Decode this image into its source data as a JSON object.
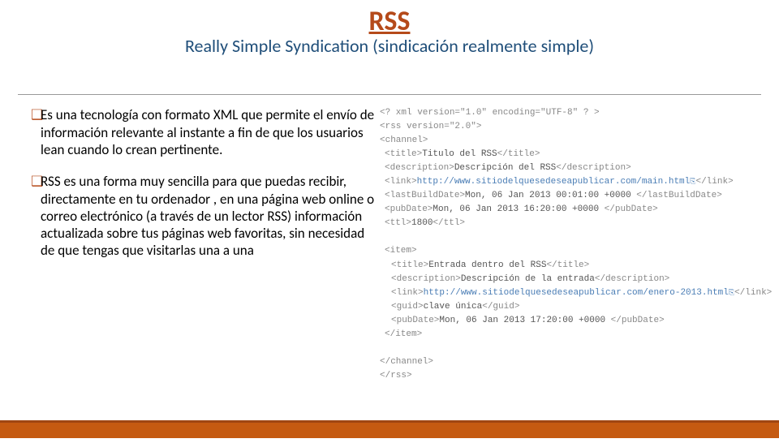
{
  "title": "RSS",
  "subtitle": "Really Simple Syndication (sindicación realmente simple)",
  "bullets": {
    "b1": "Es una  tecnología con formato XML que permite el envío de información relevante al instante a fin de que los usuarios lean cuando lo crean pertinente.",
    "b2": "RSS es una forma muy sencilla para que puedas recibir, directamente en tu ordenador , en una página web online o correo electrónico (a través de un lector RSS) información actualizada sobre tus páginas web favoritas, sin necesidad de que tengas que visitarlas una a una"
  },
  "code": {
    "l1": "<? xml version=\"1.0\" encoding=\"UTF-8\" ? >",
    "l2": "<rss version=\"2.0\">",
    "l3": "<channel>",
    "l4a": "<title>",
    "l4b": "Titulo del RSS",
    "l4c": "</title>",
    "l5a": "<description>",
    "l5b": "Descripción del RSS",
    "l5c": "</description>",
    "l6a": "<link>",
    "l6b": "http://www.sitiodelquesedeseapublicar.com/main.html",
    "l6c": "</link>",
    "l7a": "<lastBuildDate>",
    "l7b": "Mon, 06 Jan 2013 00:01:00 +0000 ",
    "l7c": "</lastBuildDate>",
    "l8a": "<pubDate>",
    "l8b": "Mon, 06 Jan 2013 16:20:00 +0000 ",
    "l8c": "</pubDate>",
    "l9a": "<ttl>",
    "l9b": "1800",
    "l9c": "</ttl>",
    "l10": "<item>",
    "l11a": "<title>",
    "l11b": "Entrada dentro del RSS",
    "l11c": "</title>",
    "l12a": "<description>",
    "l12b": "Descripción de la entrada",
    "l12c": "</description>",
    "l13a": "<link>",
    "l13b": "http://www.sitiodelquesedeseapublicar.com/enero-2013.html",
    "l13c": "</link>",
    "l14a": "<guid>",
    "l14b": "clave única",
    "l14c": "</guid>",
    "l15a": "<pubDate>",
    "l15b": "Mon, 06 Jan 2013 17:20:00 +0000 ",
    "l15c": "</pubDate>",
    "l16": "</item>",
    "l17": "</channel>",
    "l18": "</rss>",
    "linksym": "⎘"
  }
}
